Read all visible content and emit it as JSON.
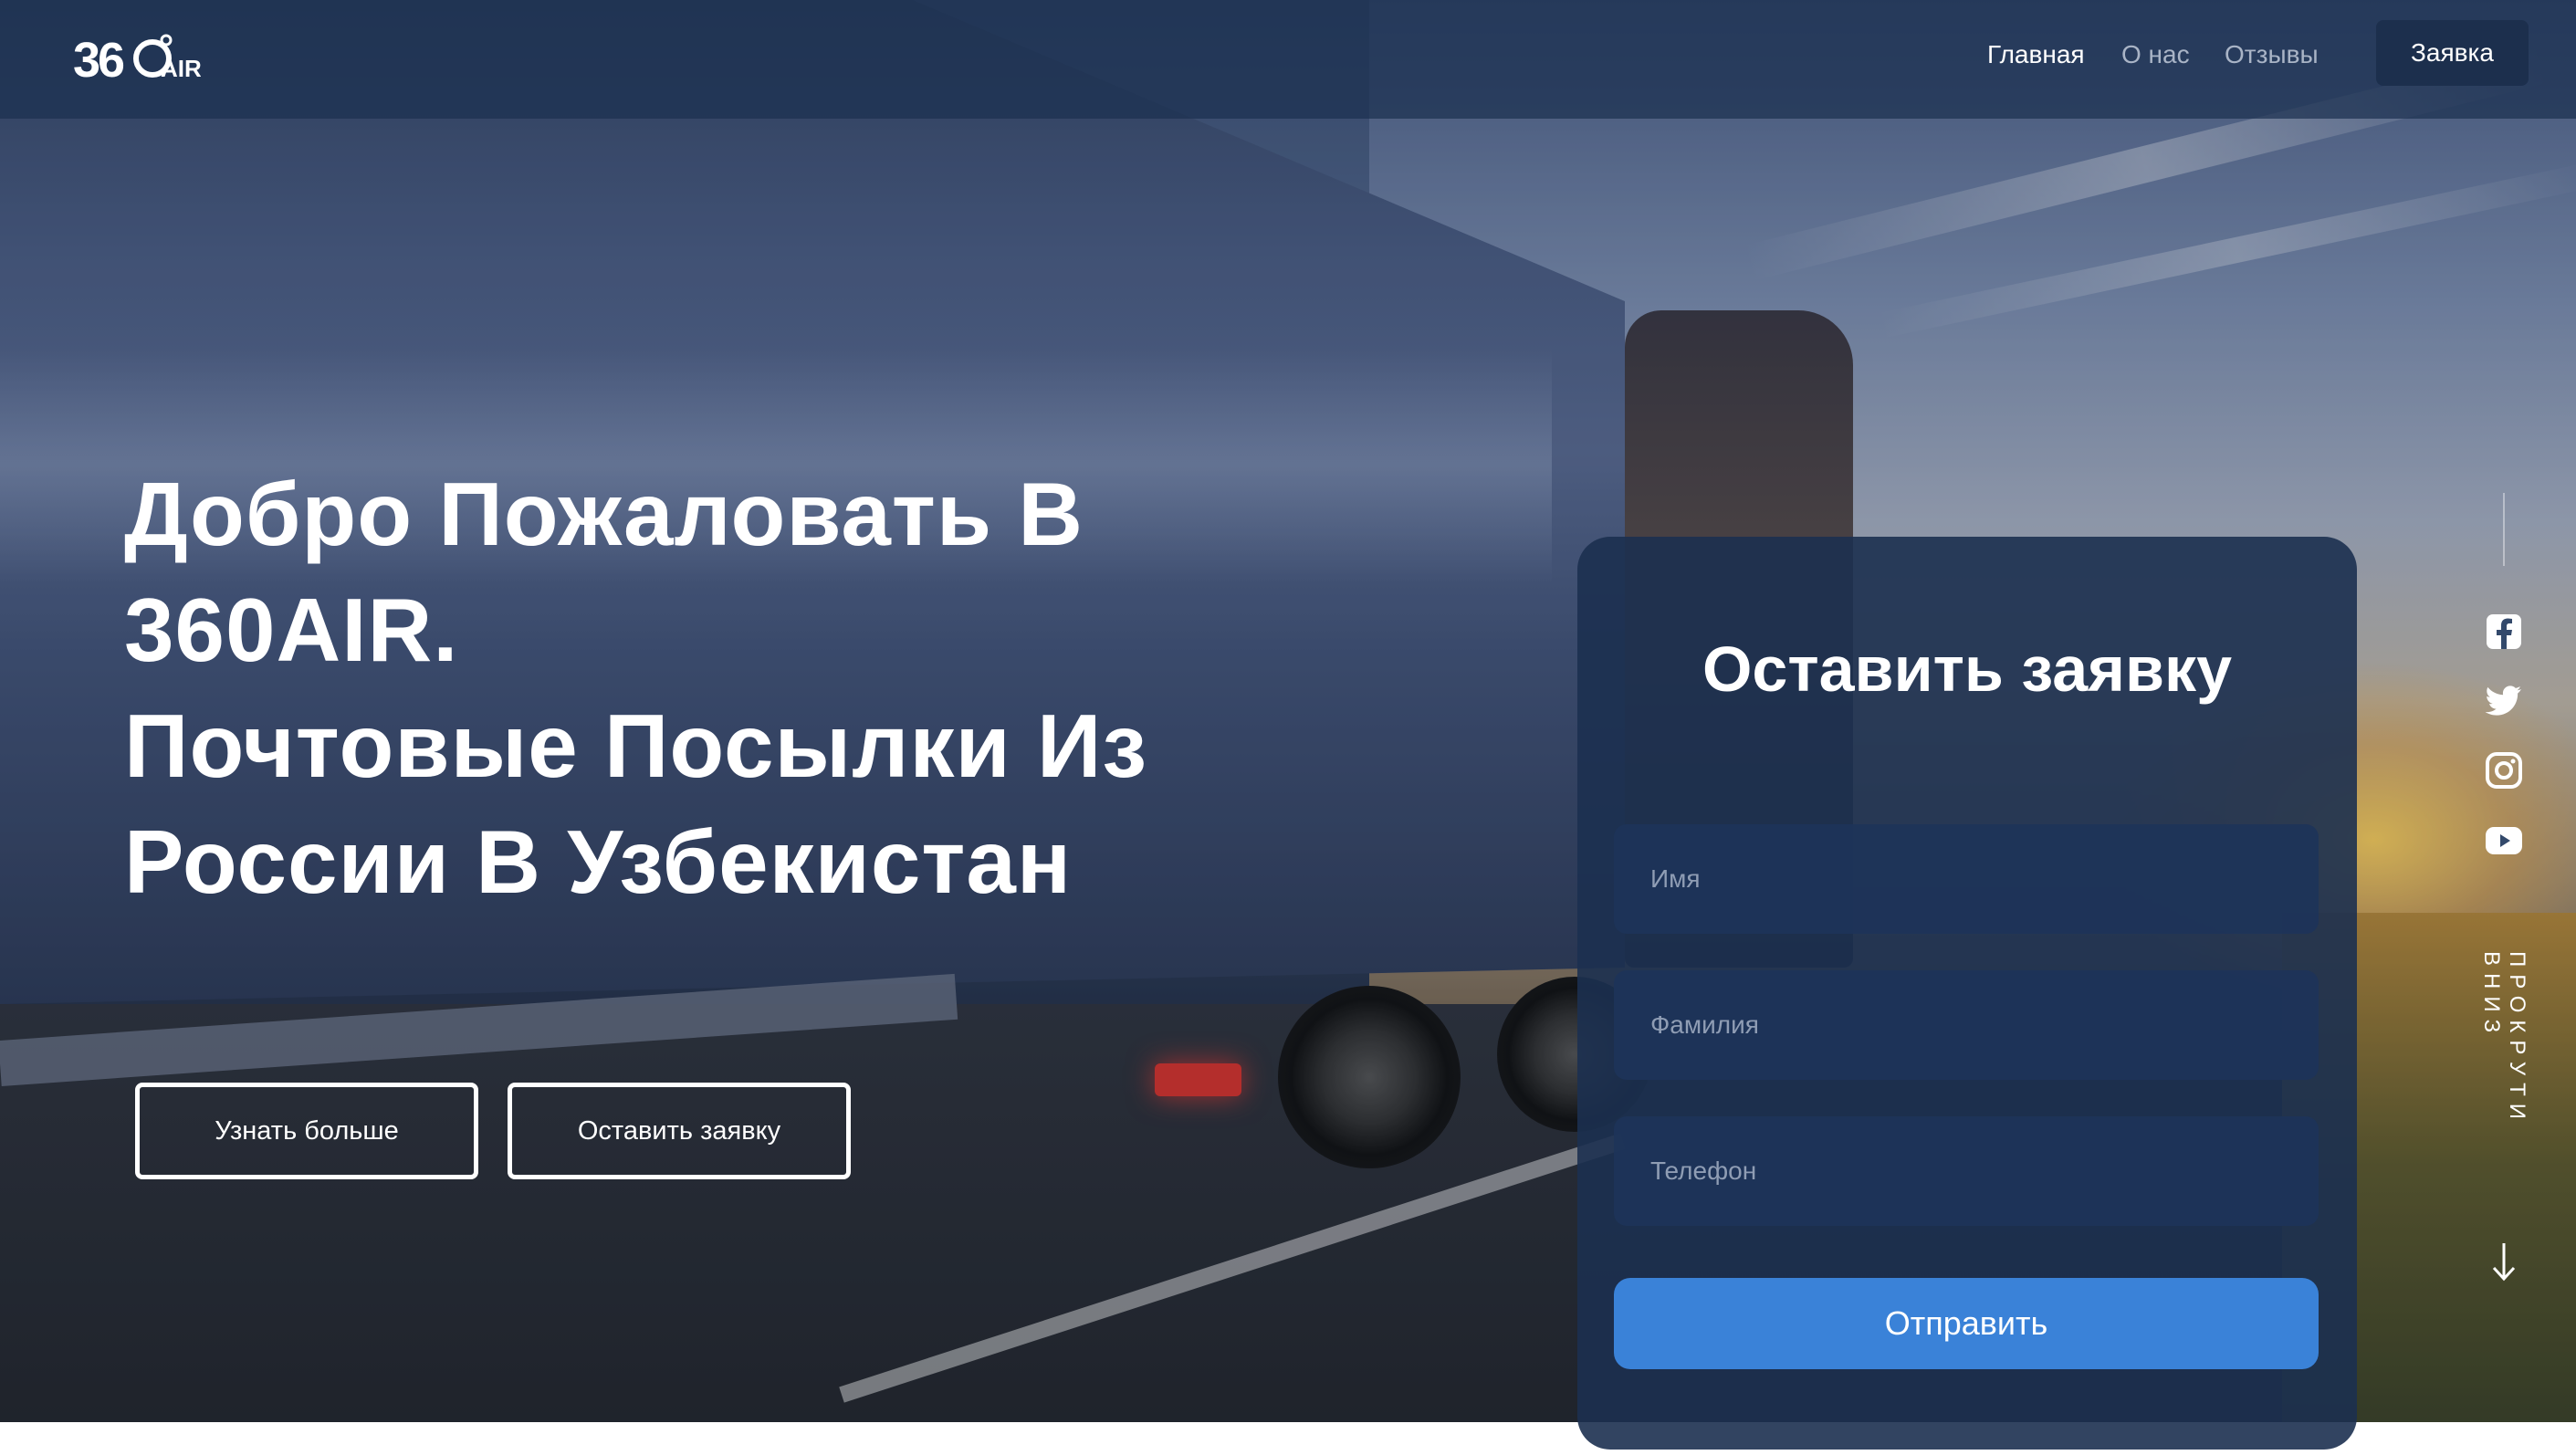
{
  "nav": {
    "logo_text": "360AIR",
    "links": [
      {
        "label": "Главная",
        "active": true
      },
      {
        "label": "О нас",
        "active": false
      },
      {
        "label": "Отзывы",
        "active": false
      }
    ],
    "cta_label": "Заявка"
  },
  "hero": {
    "title_lines": [
      "Добро Пожаловать В",
      "360AIR.",
      "Почтовые Посылки Из",
      "России В Узбекистан"
    ],
    "primary_button": "Узнать больше",
    "secondary_button": "Оставить заявку"
  },
  "form": {
    "title": "Оставить заявку",
    "first_name_placeholder": "Имя",
    "last_name_placeholder": "Фамилия",
    "phone_placeholder": "Телефон",
    "submit_label": "Отправить"
  },
  "side": {
    "social_icons": [
      "facebook-icon",
      "twitter-icon",
      "instagram-icon",
      "youtube-icon"
    ],
    "scroll_text": "ПРОКРУТИ ВНИЗ"
  },
  "colors": {
    "navbar": "#1c3050",
    "cta": "#1c2f4d",
    "form_card": "#1c3050",
    "submit": "#3a82d8",
    "text": "#ffffff"
  }
}
